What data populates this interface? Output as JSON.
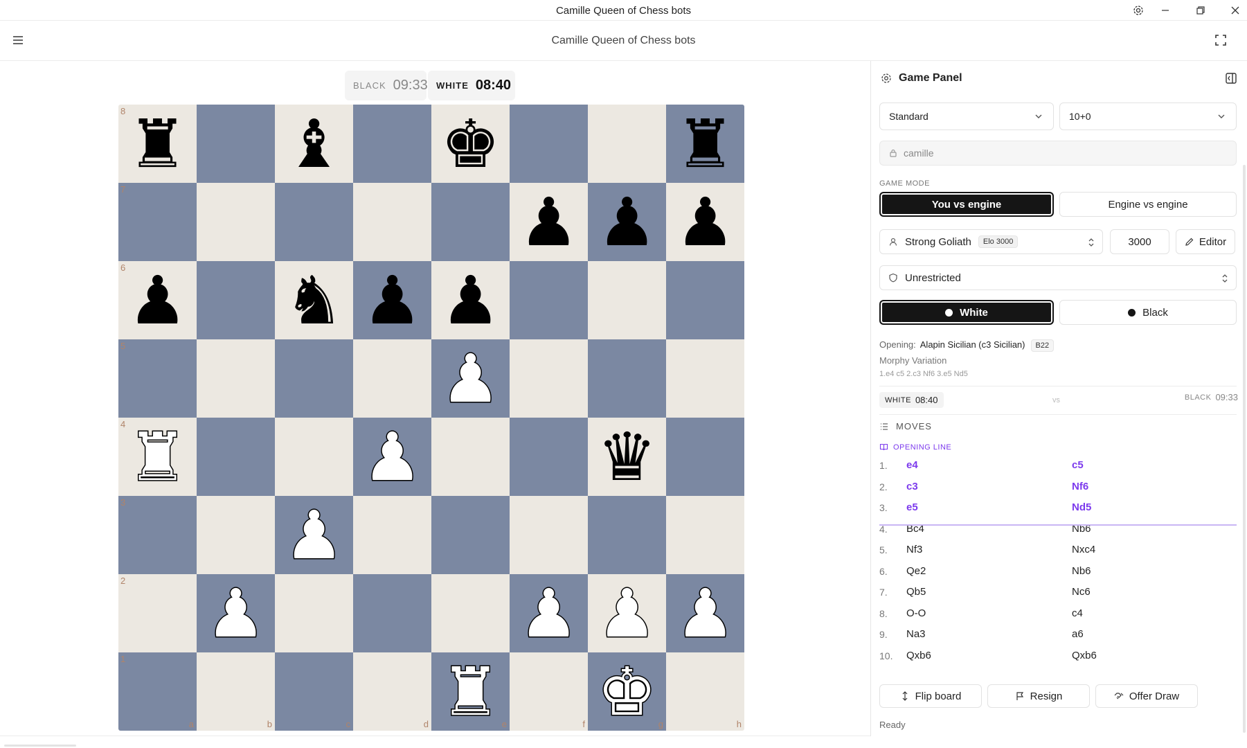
{
  "window": {
    "title": "Camille Queen of Chess bots"
  },
  "header": {
    "title": "Camille Queen of Chess bots"
  },
  "clocks": {
    "black_label": "BLACK",
    "black_time": "09:33",
    "white_label": "WHITE",
    "white_time": "08:40"
  },
  "board": {
    "ranks": [
      "8",
      "7",
      "6",
      "5",
      "4",
      "3",
      "2",
      "1"
    ],
    "files": [
      "a",
      "b",
      "c",
      "d",
      "e",
      "f",
      "g",
      "h"
    ],
    "position": [
      [
        "br",
        "",
        "bb",
        "",
        "bk",
        "",
        "",
        "br"
      ],
      [
        "",
        "",
        "",
        "",
        "",
        "bp",
        "bp",
        "bp"
      ],
      [
        "bp",
        "",
        "bn",
        "bp",
        "bp",
        "",
        "",
        ""
      ],
      [
        "",
        "",
        "",
        "",
        "wp",
        "",
        "",
        ""
      ],
      [
        "wr",
        "",
        "",
        "wp",
        "",
        "",
        "bq",
        ""
      ],
      [
        "",
        "",
        "wp",
        "",
        "",
        "",
        "",
        ""
      ],
      [
        "",
        "wp",
        "",
        "",
        "",
        "wp",
        "wp",
        "wp"
      ],
      [
        "",
        "",
        "",
        "",
        "wr",
        "",
        "wk",
        ""
      ]
    ],
    "colors": {
      "light": "#ece8e1",
      "dark": "#7b88a2",
      "coord": "#b0846a"
    }
  },
  "panel": {
    "title": "Game Panel",
    "variant": "Standard",
    "time_control": "10+0",
    "username": "camille",
    "game_mode_label": "GAME MODE",
    "mode_you": "You vs engine",
    "mode_engine": "Engine vs engine",
    "engine_name": "Strong Goliath",
    "engine_elo_badge": "Elo 3000",
    "elo_value": "3000",
    "editor_label": "Editor",
    "restriction": "Unrestricted",
    "side_white": "White",
    "side_black": "Black",
    "opening_label": "Opening:",
    "opening_name": "Alapin Sicilian (c3 Sicilian)",
    "opening_eco": "B22",
    "opening_variation": "Morphy Variation",
    "opening_line": "1.e4 c5 2.c3 Nf6 3.e5 Nd5",
    "clock_white_label": "WHITE",
    "clock_white_time": "08:40",
    "vs": "vs",
    "clock_black_label": "BLACK",
    "clock_black_time": "09:33",
    "moves_label": "MOVES",
    "opening_line_label": "OPENING LINE",
    "moves": [
      {
        "num": "1.",
        "white": "e4",
        "black": "c5"
      },
      {
        "num": "2.",
        "white": "c3",
        "black": "Nf6"
      },
      {
        "num": "3.",
        "white": "e5",
        "black": "Nd5"
      },
      {
        "num": "4.",
        "white": "Bc4",
        "black": "Nb6"
      },
      {
        "num": "5.",
        "white": "Nf3",
        "black": "Nxc4"
      },
      {
        "num": "6.",
        "white": "Qe2",
        "black": "Nb6"
      },
      {
        "num": "7.",
        "white": "Qb5",
        "black": "Nc6"
      },
      {
        "num": "8.",
        "white": "O-O",
        "black": "c4"
      },
      {
        "num": "9.",
        "white": "Na3",
        "black": "a6"
      },
      {
        "num": "10.",
        "white": "Qxb6",
        "black": "Qxb6"
      }
    ],
    "opening_moves_count": 3,
    "flip_label": "Flip board",
    "resign_label": "Resign",
    "draw_label": "Offer Draw",
    "status": "Ready",
    "accent": "#7c3aed"
  }
}
